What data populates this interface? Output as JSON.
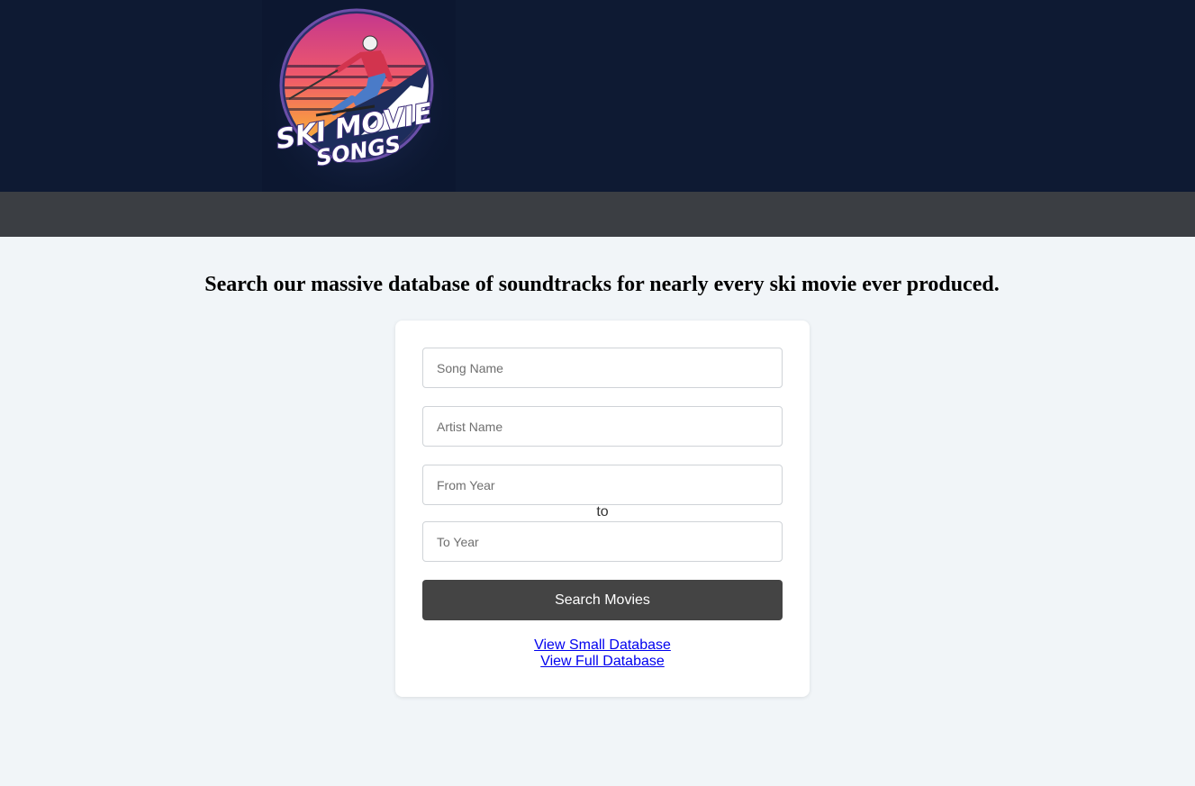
{
  "header": {
    "logo": {
      "icon": "ski-movie-songs-logo",
      "line1": "SKI MOVIE",
      "line2": "SONGS"
    }
  },
  "main": {
    "headline": "Search our massive database of soundtracks for nearly every ski movie ever produced.",
    "form": {
      "song_placeholder": "Song Name",
      "artist_placeholder": "Artist Name",
      "from_year_placeholder": "From Year",
      "to_label": "to",
      "to_year_placeholder": "To Year",
      "search_label": "Search Movies"
    },
    "links": {
      "small_db": "View Small Database",
      "full_db": "View Full Database"
    }
  },
  "colors": {
    "header_bg": "#0e1a33",
    "nav_bg": "#3b3e43",
    "page_bg": "#f1f5f8",
    "button_bg": "#444444",
    "link": "#0000ee"
  }
}
